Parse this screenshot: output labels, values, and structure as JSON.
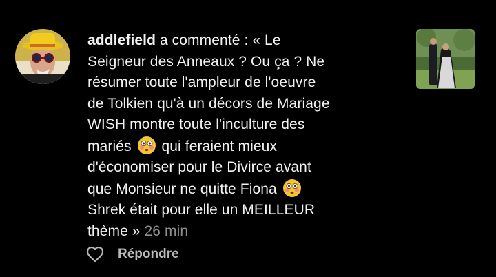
{
  "comment": {
    "username": "addlefield",
    "action": "a commenté :",
    "lines": [
      "« Le",
      "Seigneur des Anneaux ? Ou ça ? Ne",
      "résumer toute l'ampleur de l'oeuvre",
      "de Tolkien qu'à un décors de Mariage",
      "WISH montre toute l'inculture des",
      "mariés",
      "qui feraient mieux",
      "d'économiser pour le Divirce avant",
      "que Monsieur ne quitte Fiona",
      "Shrek était pour elle un MEILLEUR",
      "thème »"
    ],
    "time": "26 min"
  },
  "actions": {
    "reply_label": "Répondre",
    "like_icon": "heart-outline-icon"
  },
  "icons": {
    "emoji": "flushed-face-emoji"
  },
  "colors": {
    "background": "#000000",
    "text": "#f2f2f2",
    "timestamp": "#8e8e8e",
    "reply": "#b8b8b8"
  }
}
